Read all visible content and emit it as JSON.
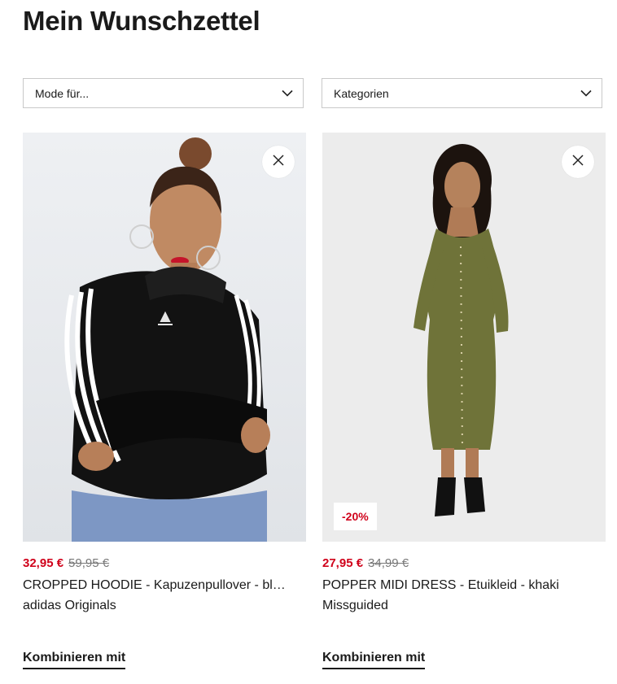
{
  "page": {
    "title": "Mein Wunschzettel"
  },
  "filters": [
    {
      "label": "Mode für...",
      "icon": "chevron-down-icon"
    },
    {
      "label": "Kategorien",
      "icon": "chevron-down-icon"
    }
  ],
  "colors": {
    "sale_red": "#d0021b",
    "text": "#1a1a1a",
    "image_bg_left": "#e7e9ec",
    "image_bg_right": "#ebebeb"
  },
  "products": [
    {
      "price_now": "32,95 €",
      "price_old": "59,95 €",
      "name": "CROPPED HOODIE - Kapuzenpullover - bl…",
      "brand": "adidas Originals",
      "discount": "",
      "combine_label": "Kombinieren mit",
      "remove_icon": "close-icon"
    },
    {
      "price_now": "27,95 €",
      "price_old": "34,99 €",
      "name": "POPPER MIDI DRESS - Etuikleid - khaki",
      "brand": "Missguided",
      "discount": "-20%",
      "combine_label": "Kombinieren mit",
      "remove_icon": "close-icon"
    }
  ]
}
